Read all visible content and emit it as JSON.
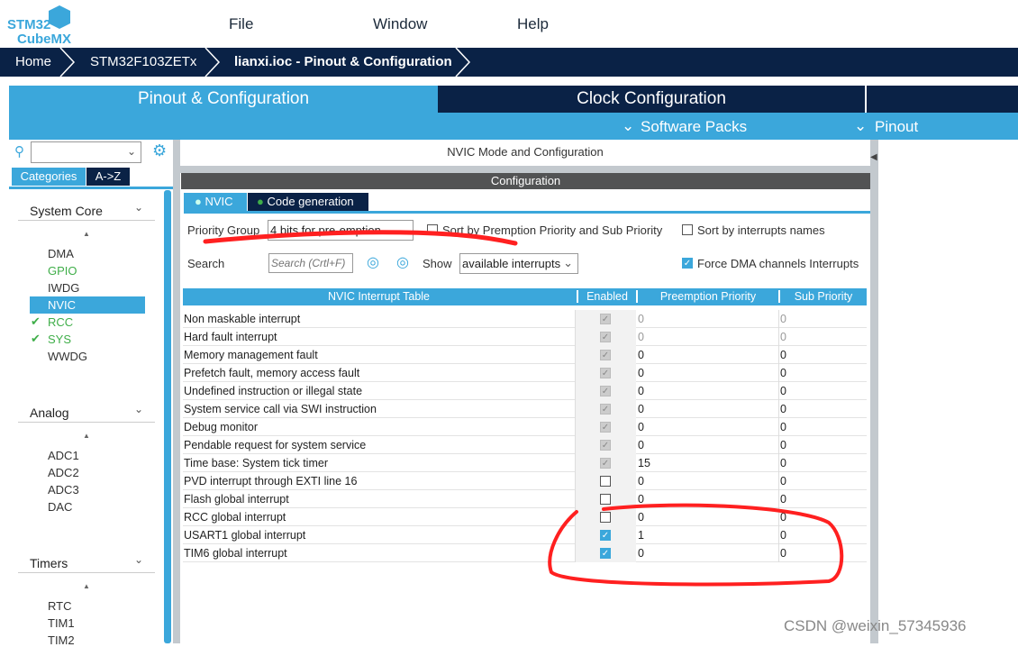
{
  "app": {
    "logo_line1": "STM32",
    "logo_line2": "CubeMX"
  },
  "menu": [
    "File",
    "Window",
    "Help"
  ],
  "breadcrumb": [
    "Home",
    "STM32F103ZETx",
    "lianxi.ioc - Pinout & Configuration"
  ],
  "tabs": [
    "Pinout & Configuration",
    "Clock Configuration"
  ],
  "subtabs": [
    "Software Packs",
    "Pinout"
  ],
  "left": {
    "view_tabs": [
      "Categories",
      "A->Z"
    ],
    "categories": [
      {
        "label": "System Core",
        "items": [
          {
            "label": "DMA",
            "state": "none"
          },
          {
            "label": "GPIO",
            "state": "configured"
          },
          {
            "label": "IWDG",
            "state": "none"
          },
          {
            "label": "NVIC",
            "state": "selected"
          },
          {
            "label": "RCC",
            "state": "checked"
          },
          {
            "label": "SYS",
            "state": "checked"
          },
          {
            "label": "WWDG",
            "state": "none"
          }
        ]
      },
      {
        "label": "Analog",
        "items": [
          {
            "label": "ADC1"
          },
          {
            "label": "ADC2"
          },
          {
            "label": "ADC3"
          },
          {
            "label": "DAC"
          }
        ]
      },
      {
        "label": "Timers",
        "items": [
          {
            "label": "RTC"
          },
          {
            "label": "TIM1"
          },
          {
            "label": "TIM2"
          }
        ]
      }
    ]
  },
  "main": {
    "title": "NVIC Mode and Configuration",
    "config_title": "Configuration",
    "config_tabs": [
      "NVIC",
      "Code generation"
    ],
    "priority_group_label": "Priority Group",
    "priority_group_value": "4 bits for pre-emption...",
    "sort_premption": "Sort by Premption Priority and Sub Priority",
    "sort_names": "Sort by interrupts names",
    "search_label": "Search",
    "search_placeholder": "Search (Crtl+F)",
    "show_label": "Show",
    "show_value": "available interrupts",
    "force_dma": "Force DMA channels Interrupts",
    "columns": [
      "NVIC Interrupt Table",
      "Enabled",
      "Preemption Priority",
      "Sub Priority"
    ],
    "rows": [
      {
        "name": "Non maskable interrupt",
        "enabled": "locked",
        "pre": "0",
        "sub": "0",
        "grey": true
      },
      {
        "name": "Hard fault interrupt",
        "enabled": "locked",
        "pre": "0",
        "sub": "0",
        "grey": true
      },
      {
        "name": "Memory management fault",
        "enabled": "locked",
        "pre": "0",
        "sub": "0"
      },
      {
        "name": "Prefetch fault, memory access fault",
        "enabled": "locked",
        "pre": "0",
        "sub": "0"
      },
      {
        "name": "Undefined instruction or illegal state",
        "enabled": "locked",
        "pre": "0",
        "sub": "0"
      },
      {
        "name": "System service call via SWI instruction",
        "enabled": "locked",
        "pre": "0",
        "sub": "0"
      },
      {
        "name": "Debug monitor",
        "enabled": "locked",
        "pre": "0",
        "sub": "0"
      },
      {
        "name": "Pendable request for system service",
        "enabled": "locked",
        "pre": "0",
        "sub": "0"
      },
      {
        "name": "Time base: System tick timer",
        "enabled": "locked",
        "pre": "15",
        "sub": "0"
      },
      {
        "name": "PVD interrupt through EXTI line 16",
        "enabled": "off",
        "pre": "0",
        "sub": "0"
      },
      {
        "name": "Flash global interrupt",
        "enabled": "off",
        "pre": "0",
        "sub": "0"
      },
      {
        "name": "RCC global interrupt",
        "enabled": "off",
        "pre": "0",
        "sub": "0"
      },
      {
        "name": "USART1 global interrupt",
        "enabled": "on",
        "pre": "1",
        "sub": "0"
      },
      {
        "name": "TIM6 global interrupt",
        "enabled": "on",
        "pre": "0",
        "sub": "0"
      }
    ]
  },
  "watermark": "CSDN @weixin_57345936",
  "colors": {
    "accent": "#3ba7db",
    "navy": "#0a2246",
    "annotation": "#ff2020",
    "green": "#3fae49"
  }
}
